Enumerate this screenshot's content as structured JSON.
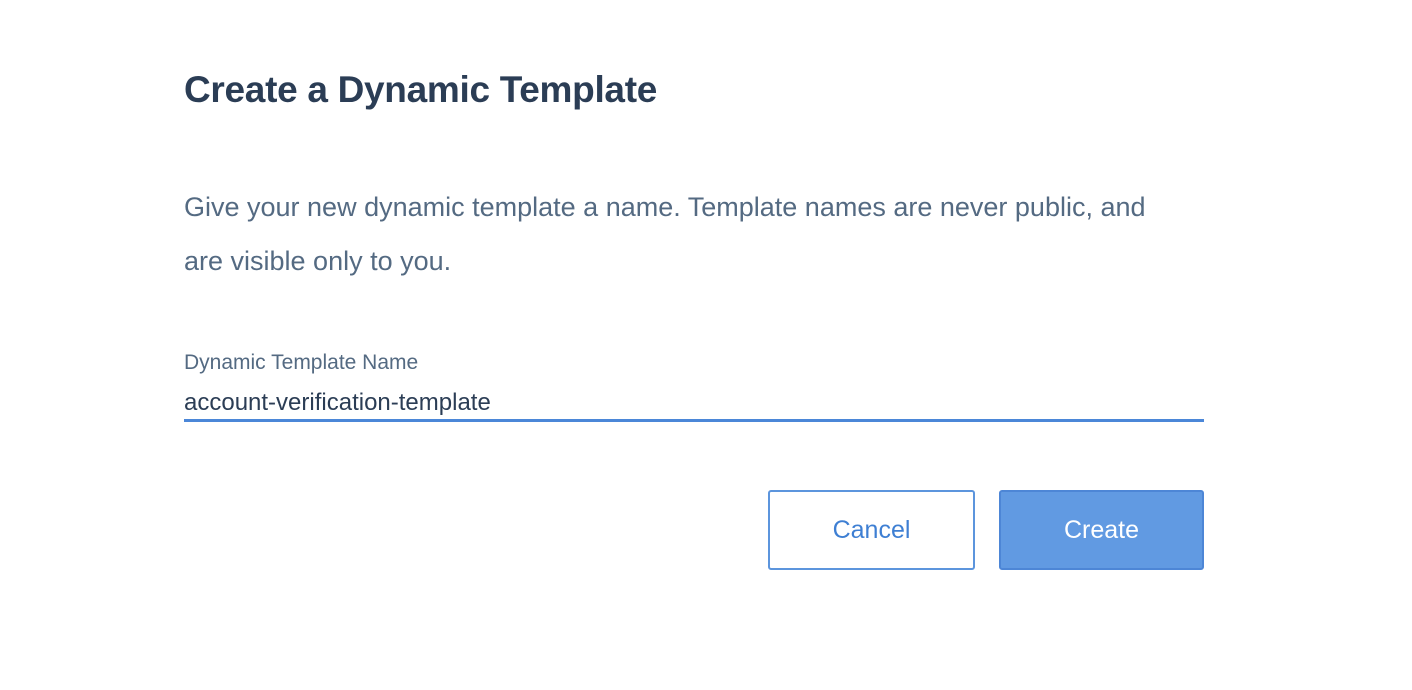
{
  "dialog": {
    "title": "Create a Dynamic Template",
    "description": "Give your new dynamic template a name. Template names are never public, and are visible only to you.",
    "field": {
      "label": "Dynamic Template Name",
      "value": "account-verification-template",
      "placeholder": ""
    },
    "buttons": {
      "cancel_label": "Cancel",
      "create_label": "Create"
    }
  },
  "colors": {
    "title_text": "#2b3d55",
    "body_text": "#546a82",
    "accent": "#4b87d8",
    "primary_button_bg": "#619ae2"
  }
}
